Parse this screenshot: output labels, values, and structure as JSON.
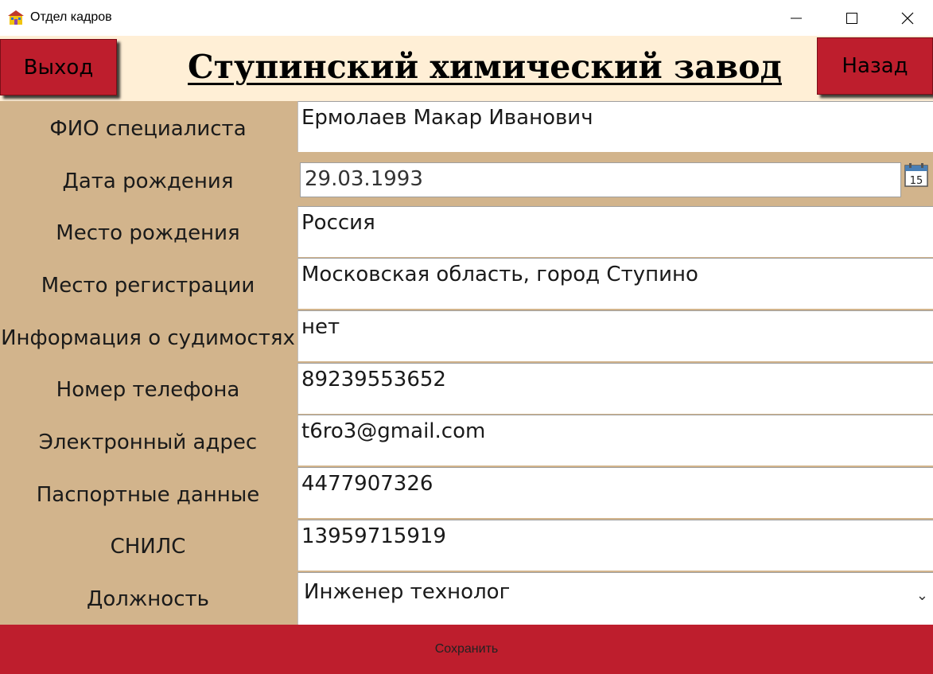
{
  "window": {
    "title": "Отдел кадров",
    "icon": "building-icon"
  },
  "header": {
    "exit_label": "Выход",
    "title": "Ступинский химический завод",
    "back_label": "Назад"
  },
  "form": {
    "rows": [
      {
        "label": "ФИО специалиста",
        "value": "Ермолаев Макар Иванович"
      },
      {
        "label": "Дата рождения",
        "value": "29.03.1993"
      },
      {
        "label": "Место рождения",
        "value": "Россия"
      },
      {
        "label": "Место регистрации",
        "value": "Московская область, город Ступино"
      },
      {
        "label": "Информация о судимостях",
        "value": "нет"
      },
      {
        "label": "Номер телефона",
        "value": "89239553652"
      },
      {
        "label": "Электронный адрес",
        "value": "t6ro3@gmail.com"
      },
      {
        "label": "Паспортные данные",
        "value": "4477907326"
      },
      {
        "label": "СНИЛС",
        "value": "13959715919"
      },
      {
        "label": "Должность",
        "value": "Инженер технолог"
      }
    ],
    "calendar_day": "15"
  },
  "footer": {
    "save_label": "Сохранить"
  },
  "colors": {
    "accent_red": "#be1e2d",
    "header_bg": "#ffefd6",
    "form_bg": "#d2b48c"
  }
}
